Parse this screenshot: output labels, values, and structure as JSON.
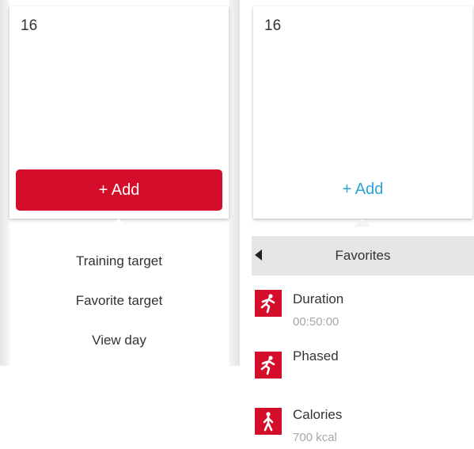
{
  "left_panel": {
    "day_number": "16",
    "add_label": "+ Add",
    "menu": [
      "Training target",
      "Favorite target",
      "View day"
    ]
  },
  "right_panel": {
    "day_number": "16",
    "add_label": "+ Add",
    "favorites_title": "Favorites",
    "favorites": [
      {
        "title": "Duration",
        "value": "00:50:00",
        "icon": "running-person-icon"
      },
      {
        "title": "Phased",
        "value": "",
        "icon": "running-person-icon"
      },
      {
        "title": "Calories",
        "value": "700 kcal",
        "icon": "walking-person-icon"
      }
    ]
  },
  "colors": {
    "accent_red": "#d40e2a",
    "link_blue": "#2aa3d9",
    "bar_gray": "#e6e6e6"
  }
}
